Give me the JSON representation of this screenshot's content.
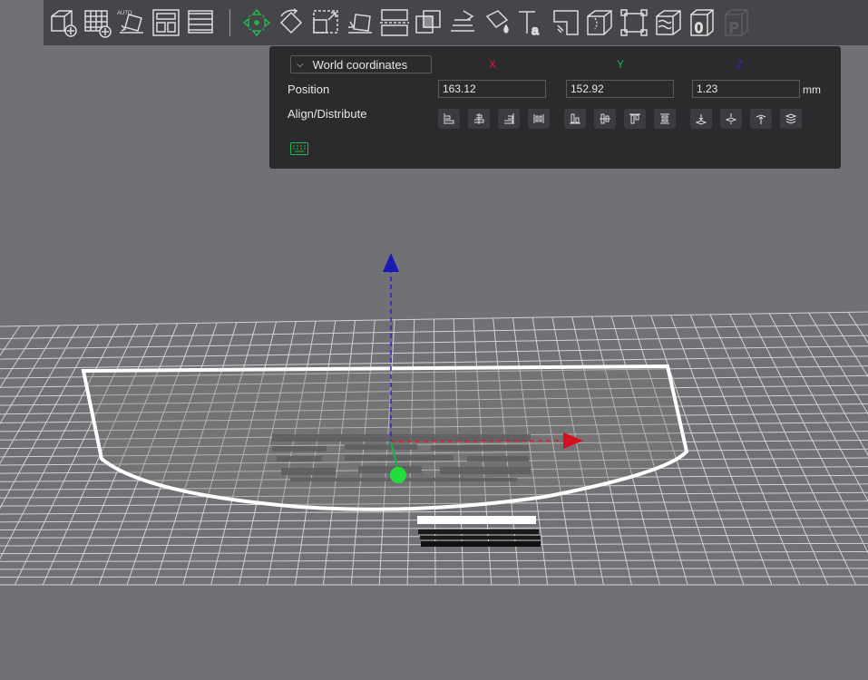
{
  "toolbar": {
    "icons": [
      "add-object",
      "add-plate",
      "auto-orient",
      "arrange",
      "split-layers",
      "move",
      "rotate",
      "scale",
      "lay-on-face",
      "cut",
      "boolean",
      "support-paint",
      "seam-paint",
      "color-paint",
      "text",
      "measure",
      "assembly",
      "variable-layer",
      "sla-support",
      "hollow",
      "p-slot"
    ]
  },
  "panel": {
    "coordinate_system": "World coordinates",
    "axes": {
      "x": "X",
      "y": "Y",
      "z": "Z"
    },
    "position_label": "Position",
    "position": {
      "x": "163.12",
      "y": "152.92",
      "z": "1.23"
    },
    "unit": "mm",
    "align_label": "Align/Distribute"
  },
  "colors": {
    "axis_x": "#e3192b",
    "axis_y": "#16b43c",
    "axis_z": "#2626cc",
    "accent_green": "#1fb84a"
  }
}
